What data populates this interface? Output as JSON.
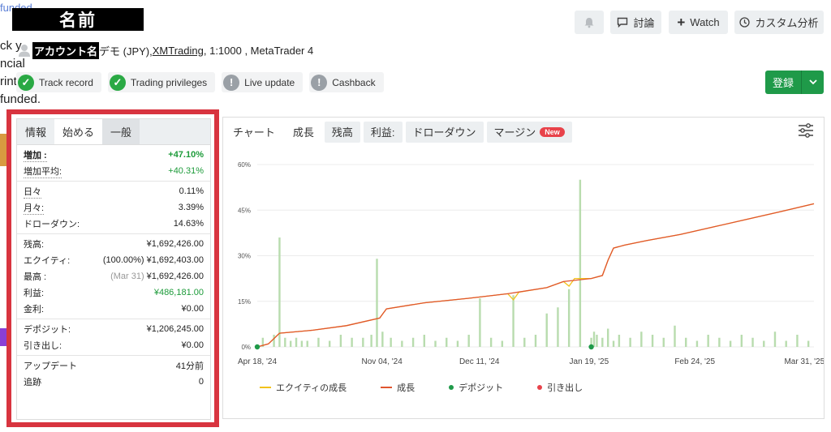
{
  "header": {
    "name_label": "名前",
    "discuss_label": "討論",
    "watch_label": "Watch",
    "custom_label": "カスタム分析"
  },
  "background_fragments": {
    "line1": "funded",
    "line2": "ck y",
    "line3": "ncial",
    "line4": "rint",
    "line5": "funded."
  },
  "account": {
    "name": "アカウント名",
    "type_text": "デモ (JPY), ",
    "broker": "XMTrading",
    "details": " , 1:1000 , MetaTrader 4"
  },
  "badges": [
    {
      "label": "Track record",
      "status": "ok"
    },
    {
      "label": "Trading privileges",
      "status": "ok"
    },
    {
      "label": "Live update",
      "status": "warn"
    },
    {
      "label": "Cashback",
      "status": "warn"
    }
  ],
  "register": {
    "label": "登録"
  },
  "stats_panel": {
    "tabs": [
      "情報",
      "始める",
      "一般"
    ],
    "gain": {
      "label": "増加 :",
      "value": "+47.10%"
    },
    "avg_gain": {
      "label": "増加平均:",
      "value": "+40.31%"
    },
    "daily": {
      "label": "日々",
      "value": "0.11%"
    },
    "monthly": {
      "label": "月々:",
      "value": "3.39%"
    },
    "drawdown": {
      "label": "ドローダウン:",
      "value": "14.63%"
    },
    "balance": {
      "label": "残高:",
      "value": "¥1,692,426.00"
    },
    "equity": {
      "label": "エクイティ:",
      "pct": "(100.00%)",
      "value": "¥1,692,403.00"
    },
    "highest": {
      "label": "最高 :",
      "date": "(Mar 31)",
      "value": "¥1,692,426.00"
    },
    "profit": {
      "label": "利益:",
      "value": "¥486,181.00"
    },
    "interest": {
      "label": "金利:",
      "value": "¥0.00"
    },
    "deposits": {
      "label": "デポジット:",
      "value": "¥1,206,245.00"
    },
    "withdrawals": {
      "label": "引き出し:",
      "value": "¥0.00"
    },
    "updated": {
      "label": "アップデート",
      "value": "41分前"
    },
    "tracking": {
      "label": "追跡",
      "value": "0"
    }
  },
  "chart_panel": {
    "tabs": [
      "チャート",
      "成長",
      "残高",
      "利益:",
      "ドローダウン",
      "マージン"
    ],
    "new_badge": "New",
    "legend": [
      "エクイティの成長",
      "成長",
      "デポジット",
      "引き出し"
    ],
    "colors": {
      "equity": "#f2c21b",
      "growth": "#e0552f",
      "deposit": "#1f9a49",
      "withdrawal": "#e8424a",
      "bars": "#b8dcae"
    }
  },
  "chart_data": {
    "type": "line",
    "title": "",
    "xlabel": "",
    "ylabel": "",
    "ylim": [
      0,
      60
    ],
    "y_ticks": [
      "0%",
      "15%",
      "30%",
      "45%",
      "60%"
    ],
    "x_ticks": [
      "Apr 18, '24",
      "Nov 04, '24",
      "Dec 11, '24",
      "Jan 19, '25",
      "Feb 24, '25",
      "Mar 31, '25"
    ],
    "x_tick_pos": [
      0,
      0.224,
      0.399,
      0.596,
      0.786,
      0.983
    ],
    "growth_series": {
      "name": "成長",
      "x": [
        0,
        0.02,
        0.04,
        0.1,
        0.16,
        0.22,
        0.226,
        0.232,
        0.3,
        0.38,
        0.45,
        0.52,
        0.55,
        0.6,
        0.62,
        0.63,
        0.64,
        0.66,
        0.7,
        0.76,
        0.82,
        0.88,
        0.94,
        1.0
      ],
      "y": [
        0,
        1,
        4.5,
        5.5,
        7,
        9.5,
        11,
        12.5,
        14.5,
        16,
        17.5,
        19.5,
        21.5,
        22.5,
        23.5,
        28.5,
        32.5,
        33.5,
        35,
        37,
        39.5,
        42,
        44.5,
        47.1
      ]
    },
    "equity_series": {
      "name": "エクイティの成長",
      "x": [
        0,
        0.02,
        0.04,
        0.1,
        0.16,
        0.22,
        0.226,
        0.232,
        0.3,
        0.38,
        0.45,
        0.46,
        0.47,
        0.52,
        0.55,
        0.56,
        0.57,
        0.6,
        0.62,
        0.63,
        0.64,
        0.66,
        0.7,
        0.76,
        0.82,
        0.88,
        0.94,
        1.0
      ],
      "y": [
        0,
        1,
        4.5,
        5.5,
        7,
        9.5,
        11,
        12.5,
        14.5,
        16,
        17.5,
        15.5,
        18,
        19.5,
        21.5,
        20,
        22.5,
        22.5,
        23.5,
        28.5,
        32.5,
        33.5,
        35,
        37,
        39.5,
        42,
        44.5,
        47.1
      ]
    },
    "deposit_markers": {
      "x": [
        0.0,
        0.6
      ],
      "y": [
        0,
        0
      ]
    },
    "volume_bars": {
      "x": [
        0.01,
        0.03,
        0.04,
        0.05,
        0.06,
        0.07,
        0.08,
        0.09,
        0.11,
        0.13,
        0.15,
        0.17,
        0.19,
        0.205,
        0.215,
        0.225,
        0.24,
        0.26,
        0.28,
        0.3,
        0.32,
        0.34,
        0.36,
        0.38,
        0.4,
        0.42,
        0.44,
        0.46,
        0.48,
        0.5,
        0.52,
        0.54,
        0.56,
        0.58,
        0.6,
        0.605,
        0.61,
        0.62,
        0.63,
        0.64,
        0.65,
        0.67,
        0.69,
        0.71,
        0.73,
        0.75,
        0.77,
        0.79,
        0.81,
        0.83,
        0.85,
        0.87,
        0.89,
        0.91,
        0.93,
        0.95,
        0.97,
        0.99
      ],
      "y": [
        3,
        4,
        36,
        3,
        2,
        3,
        2,
        2,
        3,
        2,
        4,
        3,
        3,
        4,
        29,
        5,
        3,
        2,
        3,
        4,
        2,
        3,
        2,
        4,
        16,
        3,
        2,
        17,
        3,
        4,
        11,
        13,
        19,
        55,
        3,
        5,
        4,
        3,
        6,
        2,
        4,
        3,
        5,
        4,
        3,
        7,
        3,
        2,
        4,
        3,
        2,
        4,
        3,
        2,
        5,
        2,
        4,
        2
      ]
    }
  }
}
